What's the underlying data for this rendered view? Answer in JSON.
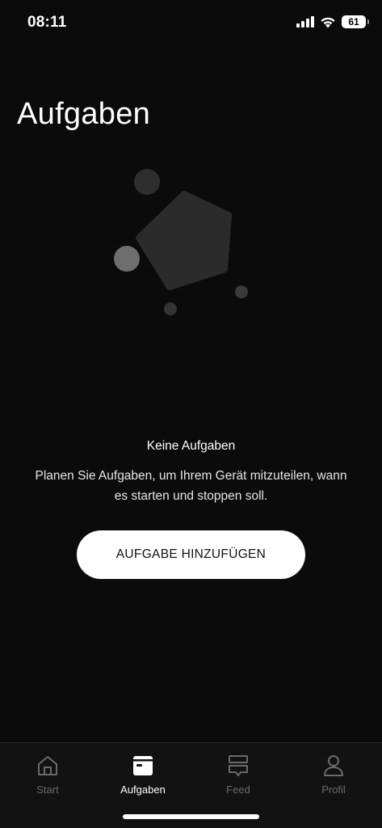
{
  "status_bar": {
    "time": "08:11",
    "battery_level": "61",
    "icons": [
      "signal-icon",
      "wifi-icon",
      "battery-icon"
    ]
  },
  "header": {
    "title": "Aufgaben"
  },
  "empty_state": {
    "illustration": "pentagon-bubbles-illustration",
    "title": "Keine Aufgaben",
    "description": "Planen Sie Aufgaben, um Ihrem Gerät mitzuteilen, wann es starten und stoppen soll.",
    "button_label": "AUFGABE HINZUFÜGEN"
  },
  "bottom_nav": {
    "items": [
      {
        "label": "Start",
        "icon": "home-icon",
        "active": false
      },
      {
        "label": "Aufgaben",
        "icon": "tasks-icon",
        "active": true
      },
      {
        "label": "Feed",
        "icon": "feed-icon",
        "active": false
      },
      {
        "label": "Profil",
        "icon": "profile-icon",
        "active": false
      }
    ]
  },
  "colors": {
    "background": "#0b0b0b",
    "nav_background": "#121212",
    "active": "#ffffff",
    "inactive": "#6a6a6a",
    "button_background": "#ffffff"
  }
}
